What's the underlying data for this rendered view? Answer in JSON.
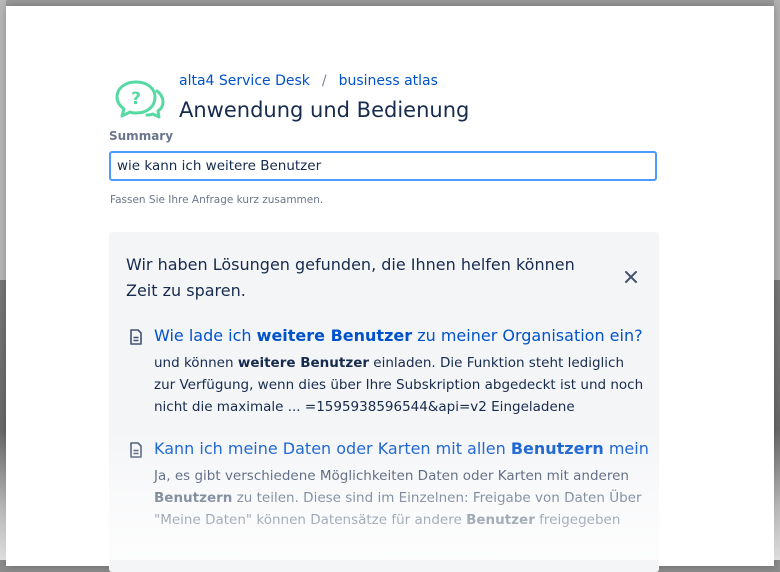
{
  "breadcrumb": {
    "service_desk": "alta4 Service Desk",
    "separator": "/",
    "project": "business atlas"
  },
  "page": {
    "title": "Anwendung und Bedienung"
  },
  "icons": {
    "logo": "chat-question-bubbles-icon",
    "close": "close-icon",
    "result": "document-icon"
  },
  "colors": {
    "link": "#0052cc",
    "logo": "#57d9a3",
    "input_border": "#4c9aff",
    "panel_bg": "#f4f5f7"
  },
  "summary": {
    "label": "Summary",
    "value": "wie kann ich weitere Benutzer",
    "helper": "Fassen Sie Ihre Anfrage kurz zusammen."
  },
  "suggestions": {
    "header": "Wir haben Lösungen gefunden, die Ihnen helfen können Zeit zu sparen.",
    "results": [
      {
        "title_parts": [
          {
            "t": "Wie lade ich ",
            "b": false
          },
          {
            "t": "weitere Benutzer",
            "b": true
          },
          {
            "t": " zu meiner Organisation ein?",
            "b": false
          }
        ],
        "excerpt_parts": [
          {
            "t": "und können ",
            "b": false
          },
          {
            "t": "weitere Benutzer",
            "b": true
          },
          {
            "t": " einladen. Die Funktion steht lediglich zur Verfügung, wenn dies über Ihre Subskription abgedeckt ist und noch nicht die maximale ... =1595938596544&api=v2 Eingeladene",
            "b": false
          }
        ]
      },
      {
        "title_parts": [
          {
            "t": "Kann ich meine Daten oder Karten mit allen ",
            "b": false
          },
          {
            "t": "Benutzern",
            "b": true
          },
          {
            "t": " meiner",
            "b": false
          }
        ],
        "excerpt_parts": [
          {
            "t": "Ja, es gibt verschiedene Möglichkeiten Daten oder Karten mit anderen ",
            "b": false
          },
          {
            "t": "Benutzern",
            "b": true
          },
          {
            "t": " zu teilen. Diese sind im Einzelnen: Freigabe von Daten Über \"Meine Daten\" können Datensätze für andere ",
            "b": false
          },
          {
            "t": "Benutzer",
            "b": true
          },
          {
            "t": " freigegeben",
            "b": false
          }
        ]
      }
    ]
  }
}
